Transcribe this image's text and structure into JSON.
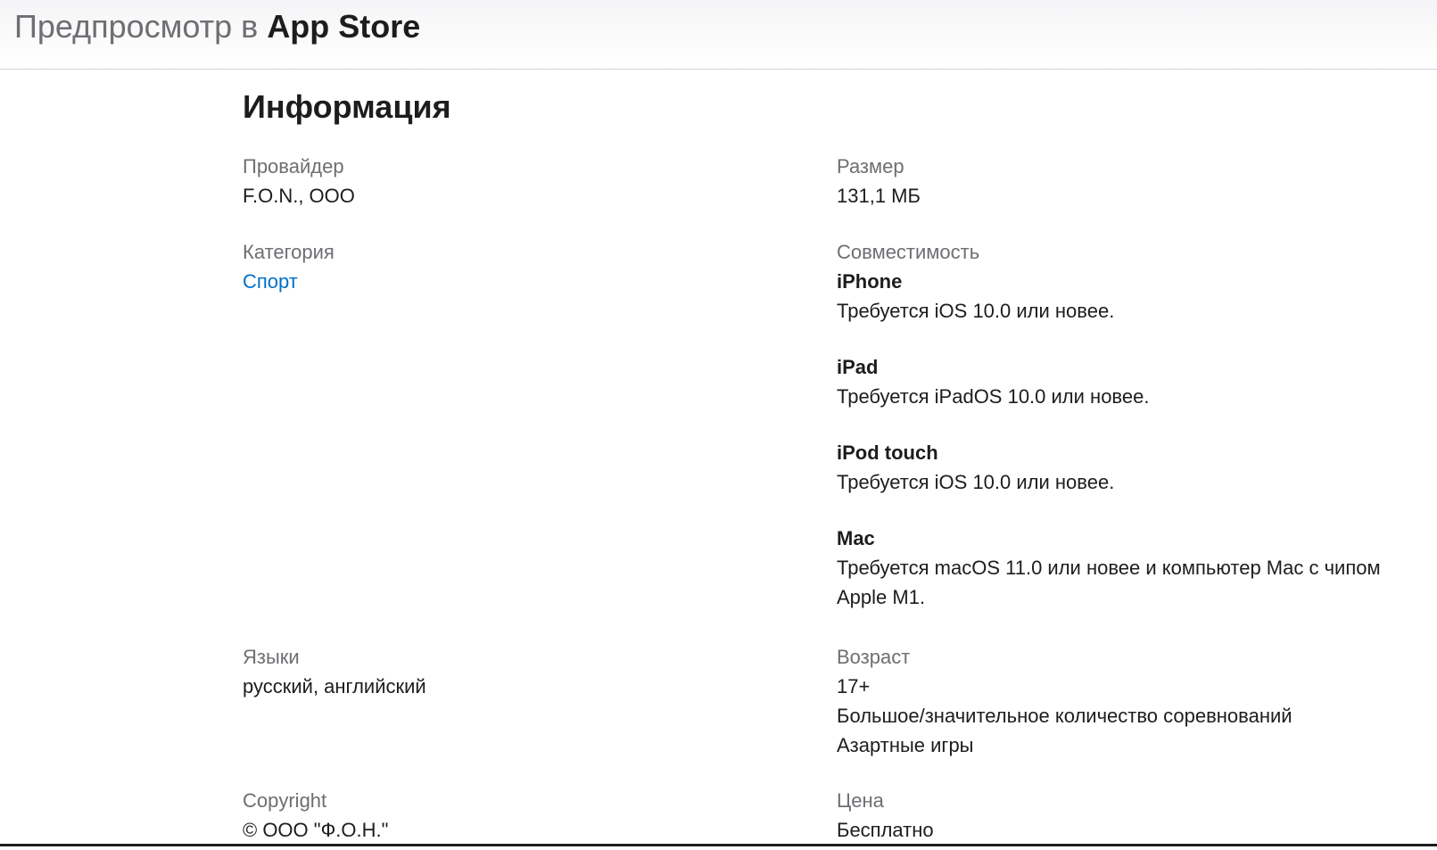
{
  "header": {
    "prefix": "Предпросмотр в",
    "brand": "App Store"
  },
  "section": {
    "title": "Информация"
  },
  "info": {
    "provider": {
      "label": "Провайдер",
      "value": "F.O.N., ООО"
    },
    "category": {
      "label": "Категория",
      "value": "Спорт"
    },
    "languages": {
      "label": "Языки",
      "value": "русский, английский"
    },
    "copyright": {
      "label": "Copyright",
      "value": "© ООО \"Ф.О.Н.\""
    },
    "size": {
      "label": "Размер",
      "value": "131,1 МБ"
    },
    "compatibility": {
      "label": "Совместимость",
      "devices": [
        {
          "name": "iPhone",
          "requirement": "Требуется iOS 10.0 или новее."
        },
        {
          "name": "iPad",
          "requirement": "Требуется iPadOS 10.0 или новее."
        },
        {
          "name": "iPod touch",
          "requirement": "Требуется iOS 10.0 или новее."
        },
        {
          "name": "Mac",
          "requirement": "Требуется macOS 11.0 или новее и компьютер Mac с чипом Apple M1."
        }
      ]
    },
    "age": {
      "label": "Возраст",
      "value": "17+",
      "reasons": [
        "Большое/значительное количество соревнований",
        "Азартные игры"
      ]
    },
    "price": {
      "label": "Цена",
      "value": "Бесплатно"
    }
  },
  "colors": {
    "link": "#0070c9",
    "label": "#6e6e73",
    "text": "#1d1d1f"
  }
}
